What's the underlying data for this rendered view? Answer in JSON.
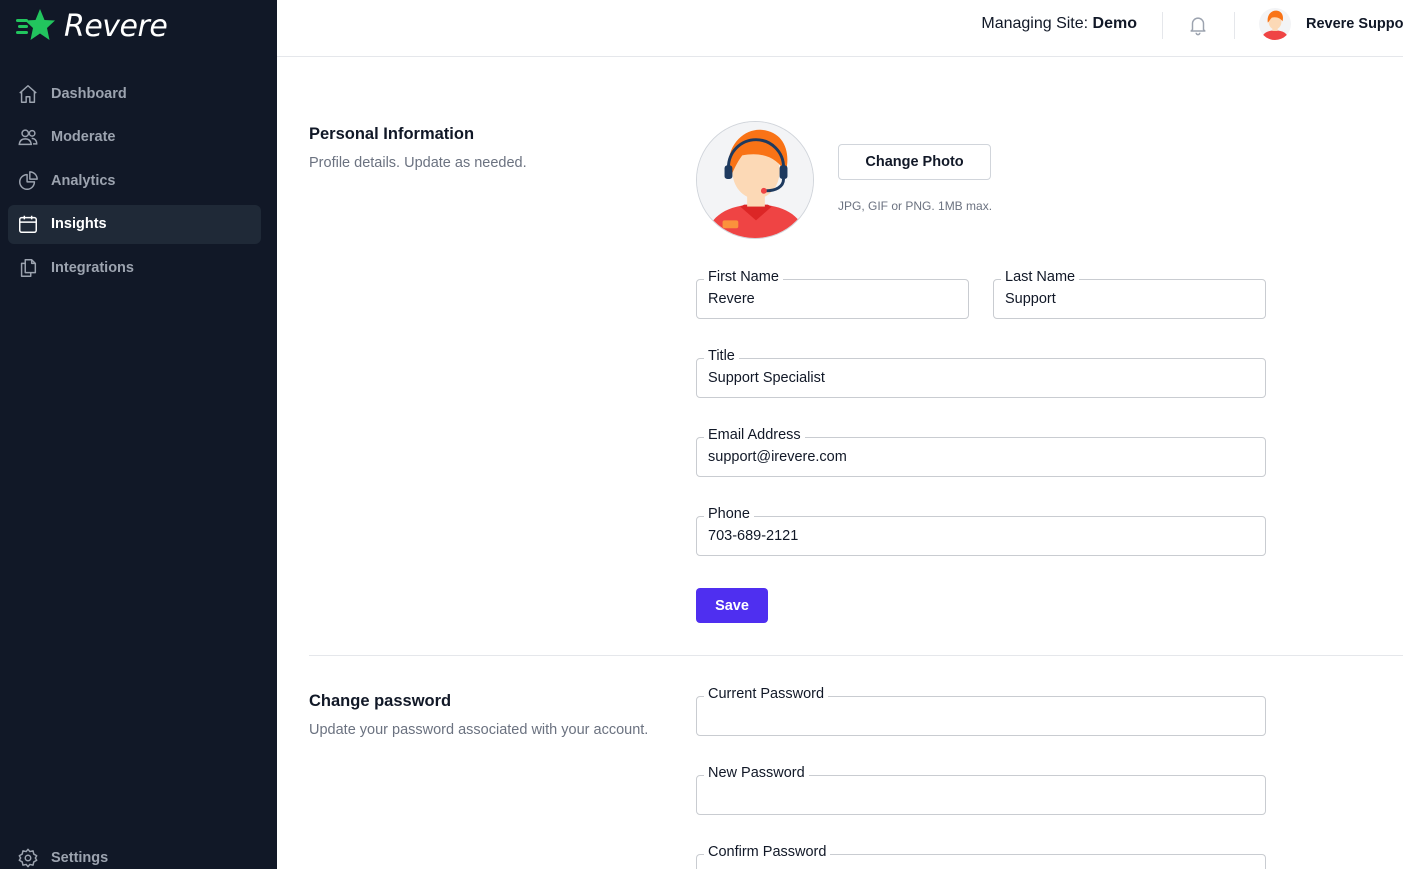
{
  "app": {
    "name": "Revere"
  },
  "sidebar": {
    "items": [
      {
        "label": "Dashboard",
        "icon": "home-icon"
      },
      {
        "label": "Moderate",
        "icon": "users-icon"
      },
      {
        "label": "Analytics",
        "icon": "pie-chart-icon"
      },
      {
        "label": "Insights",
        "icon": "calendar-icon",
        "active": true
      },
      {
        "label": "Integrations",
        "icon": "documents-icon"
      }
    ],
    "settings_label": "Settings"
  },
  "header": {
    "managing_prefix": "Managing Site: ",
    "site_name": "Demo",
    "user_name": "Revere Support"
  },
  "personal": {
    "title": "Personal Information",
    "description": "Profile details. Update as needed.",
    "change_photo_label": "Change Photo",
    "photo_hint": "JPG, GIF or PNG. 1MB max.",
    "first_name": {
      "label": "First Name",
      "value": "Revere"
    },
    "last_name": {
      "label": "Last Name",
      "value": "Support"
    },
    "job_title": {
      "label": "Title",
      "value": "Support Specialist"
    },
    "email": {
      "label": "Email Address",
      "value": "support@irevere.com"
    },
    "phone": {
      "label": "Phone",
      "value": "703-689-2121"
    },
    "save_label": "Save"
  },
  "password": {
    "title": "Change password",
    "description": "Update your password associated with your account.",
    "current": {
      "label": "Current Password",
      "value": ""
    },
    "new": {
      "label": "New Password",
      "value": ""
    },
    "confirm": {
      "label": "Confirm Password",
      "value": ""
    }
  },
  "colors": {
    "sidebar_bg": "#111827",
    "active_item_bg": "#1f2937",
    "brand_green": "#22c55e",
    "primary_button": "#4f2ff0"
  }
}
